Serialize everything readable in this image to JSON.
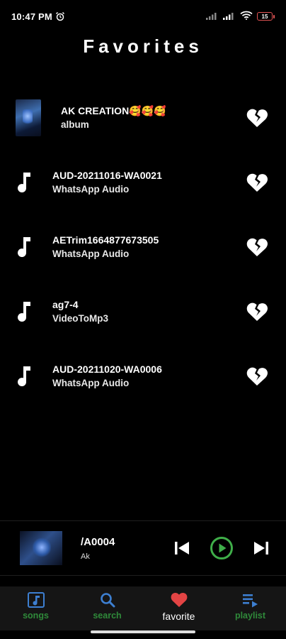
{
  "status": {
    "time": "10:47 PM",
    "battery": "15"
  },
  "page_title": "Favorites",
  "favorites": [
    {
      "title": "AK CREATION🥰🥰🥰",
      "subtitle": "album",
      "type": "album"
    },
    {
      "title": "AUD-20211016-WA0021",
      "subtitle": "WhatsApp Audio",
      "type": "audio"
    },
    {
      "title": "AETrim1664877673505",
      "subtitle": "WhatsApp Audio",
      "type": "audio"
    },
    {
      "title": "ag7-4",
      "subtitle": "VideoToMp3",
      "type": "audio"
    },
    {
      "title": "AUD-20211020-WA0006",
      "subtitle": "WhatsApp Audio",
      "type": "audio"
    }
  ],
  "now_playing": {
    "song": "/A0004",
    "artist": "Ak"
  },
  "nav": {
    "tabs": [
      {
        "label": "songs",
        "color": "#3d7fd1"
      },
      {
        "label": "search",
        "color": "#3d7fd1"
      },
      {
        "label": "favorite",
        "color": "#e34444"
      },
      {
        "label": "playlist",
        "color": "#3d7fd1"
      }
    ]
  },
  "colors": {
    "accent_green": "#3fae49",
    "label_green": "#2f8a3a",
    "heart_red": "#e34444"
  }
}
